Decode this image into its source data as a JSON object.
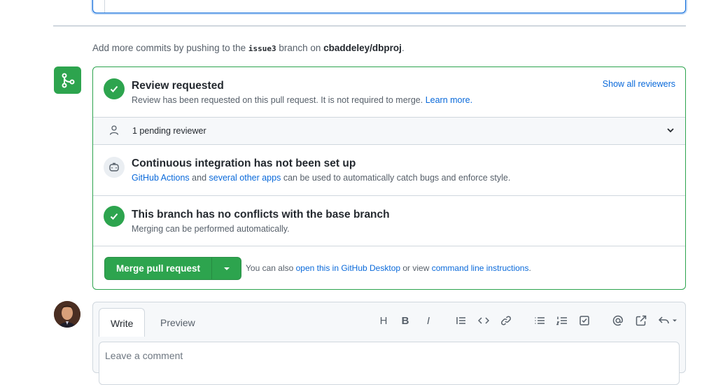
{
  "commits_hint": {
    "prefix": "Add more commits by pushing to the ",
    "branch": "issue3",
    "middle": " branch on ",
    "repo": "cbaddeley/dbproj",
    "suffix": "."
  },
  "merge_box": {
    "review": {
      "title": "Review requested",
      "desc": "Review has been requested on this pull request. It is not required to merge. ",
      "learn_more": "Learn more.",
      "show_all": "Show all reviewers"
    },
    "pending": {
      "label": "1 pending reviewer"
    },
    "ci": {
      "title": "Continuous integration has not been set up",
      "link1": "GitHub Actions",
      "and": " and ",
      "link2": "several other apps",
      "rest": " can be used to automatically catch bugs and enforce style."
    },
    "conflicts": {
      "title": "This branch has no conflicts with the base branch",
      "desc": "Merging can be performed automatically."
    },
    "merge_button": "Merge pull request",
    "also_prefix": "You can also ",
    "desktop_link": "open this in GitHub Desktop",
    "or_view": " or view ",
    "cli_link": "command line instructions",
    "also_suffix": "."
  },
  "comment": {
    "tabs": [
      "Write",
      "Preview"
    ],
    "toolbar": {
      "heading": "H",
      "bold": "B",
      "italic": "I"
    },
    "placeholder": "Leave a comment"
  },
  "colors": {
    "success": "#2da44e",
    "link": "#0969da",
    "muted": "#57606a",
    "border": "#d0d7de"
  }
}
